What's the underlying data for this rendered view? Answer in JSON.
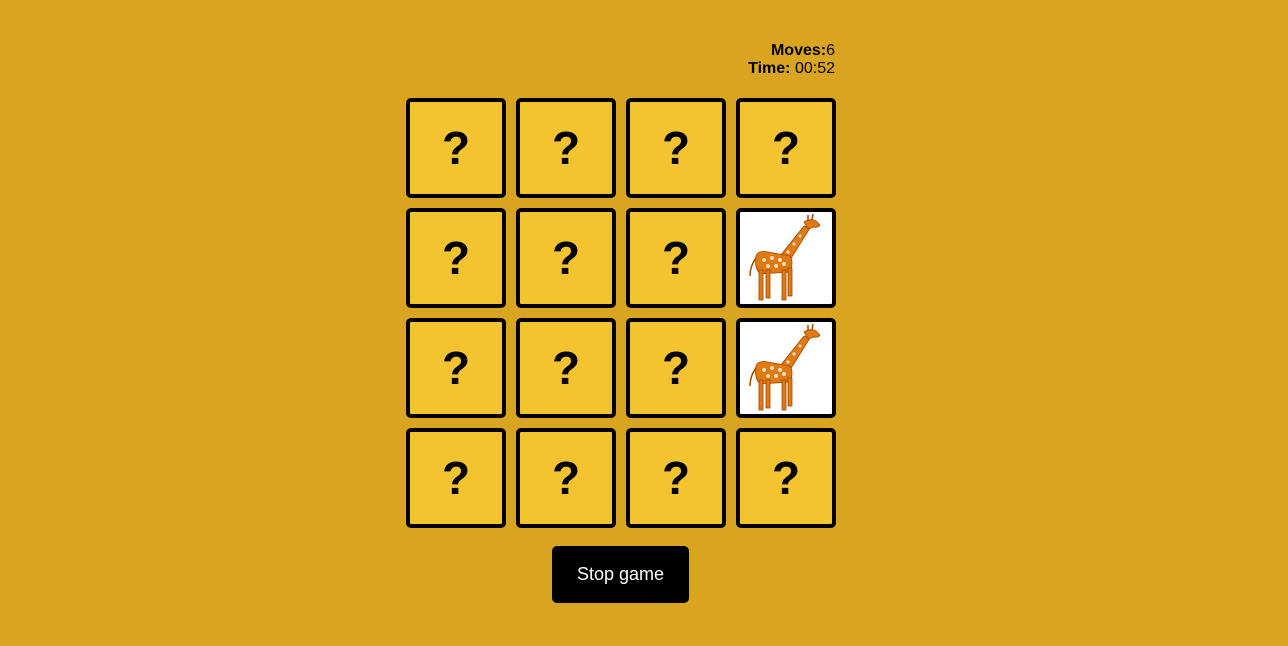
{
  "stats": {
    "moves_label": "Moves:",
    "moves_value": "6",
    "time_label": "Time:",
    "time_value": "00:52"
  },
  "cards": [
    {
      "state": "hidden",
      "face": "?"
    },
    {
      "state": "hidden",
      "face": "?"
    },
    {
      "state": "hidden",
      "face": "?"
    },
    {
      "state": "hidden",
      "face": "?"
    },
    {
      "state": "hidden",
      "face": "?"
    },
    {
      "state": "hidden",
      "face": "?"
    },
    {
      "state": "hidden",
      "face": "?"
    },
    {
      "state": "revealed",
      "face": "giraffe"
    },
    {
      "state": "hidden",
      "face": "?"
    },
    {
      "state": "hidden",
      "face": "?"
    },
    {
      "state": "hidden",
      "face": "?"
    },
    {
      "state": "revealed",
      "face": "giraffe"
    },
    {
      "state": "hidden",
      "face": "?"
    },
    {
      "state": "hidden",
      "face": "?"
    },
    {
      "state": "hidden",
      "face": "?"
    },
    {
      "state": "hidden",
      "face": "?"
    }
  ],
  "stop_button_label": "Stop game",
  "colors": {
    "background": "#d9a520",
    "card_back": "#f4c430",
    "card_border": "#000000",
    "button": "#000000",
    "giraffe": "#e07a10"
  }
}
